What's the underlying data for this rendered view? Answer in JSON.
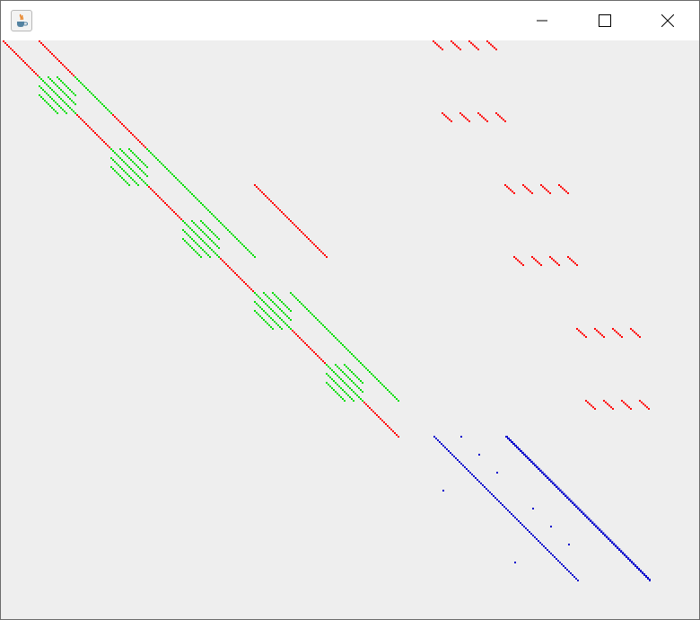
{
  "window": {
    "title": "",
    "icon": "java-coffee-cup-icon",
    "controls": [
      "minimize-icon",
      "maximize-icon",
      "close-icon"
    ]
  },
  "chart_data": {
    "type": "scatter",
    "title": "",
    "description_colors": {
      "red": "#ff0000",
      "green": "#00dd00",
      "blue": "#0000cc"
    },
    "xlim": [
      0,
      72
    ],
    "ylim": [
      0,
      60
    ],
    "series": [
      {
        "color": "#ff0000",
        "diagonals": [
          {
            "from": [
              0,
              0
            ],
            "to": [
              44,
              44
            ]
          },
          {
            "from": [
              4,
              0
            ],
            "to": [
              8,
              4
            ]
          },
          {
            "from": [
              12,
              8
            ],
            "to": [
              20,
              16
            ]
          },
          {
            "from": [
              28,
              16
            ],
            "to": [
              36,
              24
            ]
          }
        ],
        "segments": [
          {
            "row": 0,
            "cols": [
              48,
              50,
              52,
              54
            ]
          },
          {
            "row": 8,
            "cols": [
              49,
              51,
              53,
              55
            ]
          },
          {
            "row": 16,
            "cols": [
              56,
              58,
              60,
              62
            ]
          },
          {
            "row": 24,
            "cols": [
              57,
              59,
              61,
              63
            ]
          },
          {
            "row": 32,
            "cols": [
              64,
              66,
              68,
              70
            ]
          },
          {
            "row": 40,
            "cols": [
              65,
              67,
              69,
              71
            ]
          }
        ]
      },
      {
        "color": "#00dd00",
        "diagonals": [
          {
            "from": [
              8,
              4
            ],
            "to": [
              12,
              8
            ]
          },
          {
            "from": [
              16,
              12
            ],
            "to": [
              20,
              16
            ]
          },
          {
            "from": [
              20,
              16
            ],
            "to": [
              28,
              24
            ]
          },
          {
            "from": [
              32,
              28
            ],
            "to": [
              44,
              40
            ]
          }
        ],
        "blocks": [
          {
            "origin": [
              4,
              4
            ]
          },
          {
            "origin": [
              12,
              12
            ]
          },
          {
            "origin": [
              20,
              20
            ]
          },
          {
            "origin": [
              28,
              28
            ]
          },
          {
            "origin": [
              36,
              36
            ]
          }
        ]
      },
      {
        "color": "#0000cc",
        "diagonals": [
          {
            "from": [
              48,
              44
            ],
            "to": [
              64,
              60
            ]
          },
          {
            "from": [
              56,
              44
            ],
            "to": [
              72,
              60
            ]
          },
          {
            "from": [
              56.1,
              44
            ],
            "to": [
              72,
              59.9
            ]
          }
        ],
        "points": [
          [
            51,
            44
          ],
          [
            53,
            46
          ],
          [
            55,
            48
          ],
          [
            49,
            50
          ],
          [
            59,
            52
          ],
          [
            61,
            54
          ],
          [
            63,
            56
          ],
          [
            57,
            58
          ]
        ]
      }
    ]
  }
}
